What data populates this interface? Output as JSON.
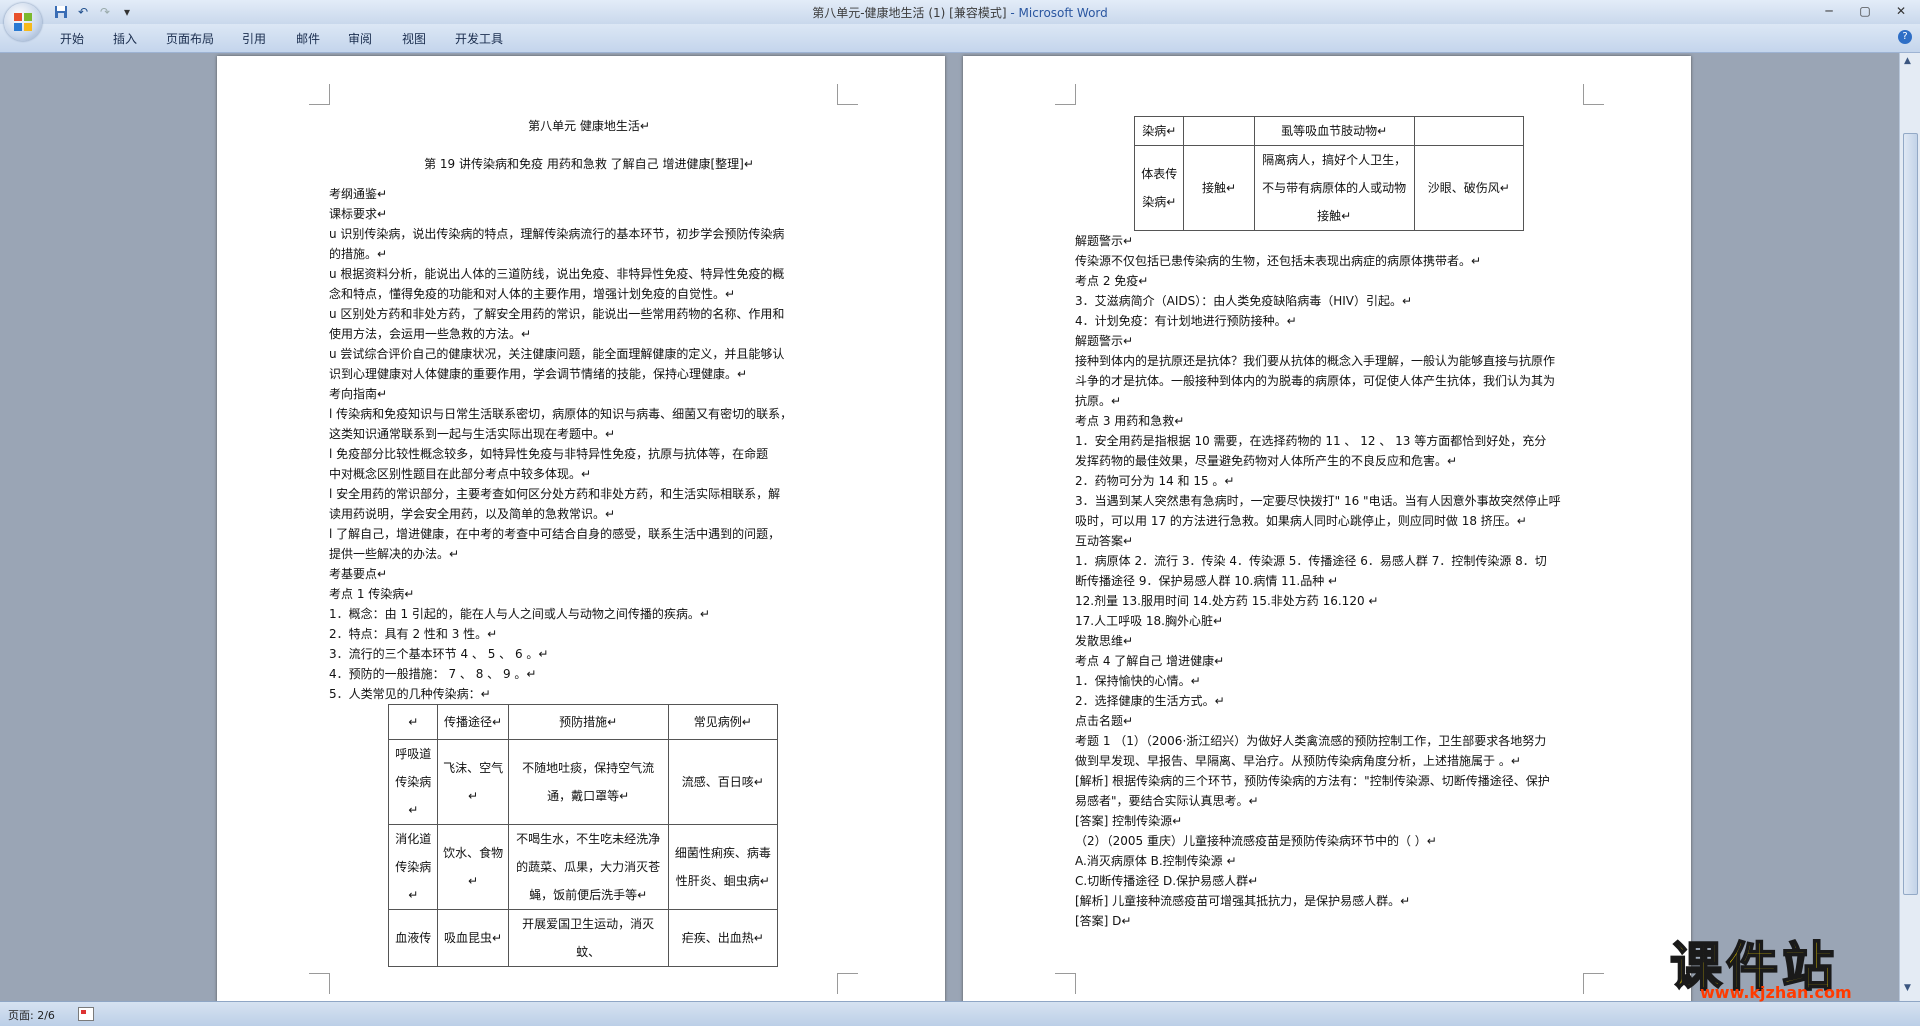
{
  "window": {
    "title": "第八单元-健康地生活 (1) [兼容模式]",
    "app_name": " - Microsoft Word"
  },
  "qat": {
    "undo_icon": "↶",
    "redo_icon": "↷",
    "more_icon": "▾"
  },
  "tabs": [
    "开始",
    "插入",
    "页面布局",
    "引用",
    "邮件",
    "审阅",
    "视图",
    "开发工具"
  ],
  "status": {
    "page": "页面: 2/6"
  },
  "watermark": {
    "cn": "课件站",
    "url": "www.kjzhan.com"
  },
  "page1": {
    "title1": "第八单元 健康地生活↵",
    "title2": "第 19 讲传染病和免疫 用药和急救 了解自己 增进健康[整理]↵",
    "lines": [
      "考纲通鉴↵",
      "课标要求↵",
      "u 识别传染病，说出传染病的特点，理解传染病流行的基本环节，初步学会预防传染病",
      "的措施。↵",
      "u 根据资料分析，能说出人体的三道防线，说出免疫、非特异性免疫、特异性免疫的概",
      "念和特点，懂得免疫的功能和对人体的主要作用，增强计划免疫的自觉性。↵",
      "u 区别处方药和非处方药，了解安全用药的常识，能说出一些常用药物的名称、作用和",
      "使用方法，会运用一些急救的方法。↵",
      "u 尝试综合评价自己的健康状况，关注健康问题，能全面理解健康的定义，并且能够认",
      "识到心理健康对人体健康的重要作用，学会调节情绪的技能，保持心理健康。↵",
      "考向指南↵",
      "l 传染病和免疫知识与日常生活联系密切，病原体的知识与病毒、细菌又有密切的联系，",
      "这类知识通常联系到一起与生活实际出现在考题中。↵",
      "l 免疫部分比较性概念较多，如特异性免疫与非特异性免疫，抗原与抗体等，在命题",
      "中对概念区别性题目在此部分考点中较多体现。↵",
      "l 安全用药的常识部分，主要考查如何区分处方药和非处方药，和生活实际相联系，解",
      "读用药说明，学会安全用药，以及简单的急救常识。↵",
      "l 了解自己，增进健康，在中考的考查中可结合自身的感受，联系生活中遇到的问题，",
      "提供一些解决的办法。↵",
      "考基要点↵",
      "考点 1 传染病↵",
      "1．概念：由 1 引起的，能在人与人之间或人与动物之间传播的疾病。↵",
      "2．特点：具有 2 性和 3 性。↵",
      "3．流行的三个基本环节 4 、 5 、 6 。↵",
      "4．预防的一般措施： 7 、 8 、 9 。↵",
      "5．人类常见的几种传染病：↵"
    ],
    "table": {
      "header": [
        "↵",
        "传播途径↵",
        "预防措施↵",
        "常见病例↵"
      ],
      "rows": [
        [
          "呼吸道传染病↵",
          "飞沫、空气↵",
          "不随地吐痰，保持空气流通，戴口罩等↵",
          "流感、百日咳↵"
        ],
        [
          "消化道传染病↵",
          "饮水、食物↵",
          "不喝生水，不生吃未经洗净的蔬菜、瓜果，大力消灭苍蝇，饭前便后洗手等↵",
          "细菌性痢疾、病毒性肝炎、蛔虫病↵"
        ],
        [
          "血液传",
          "吸血昆虫↵",
          "开展爱国卫生运动，消灭蚊、",
          "疟疾、出血热↵"
        ]
      ]
    }
  },
  "page2": {
    "table": {
      "rows": [
        [
          "染病↵",
          "",
          "虱等吸血节肢动物↵",
          ""
        ],
        [
          "体表传染病↵",
          "接触↵",
          "隔离病人，搞好个人卫生，不与带有病原体的人或动物接触↵",
          "沙眼、破伤风↵"
        ]
      ]
    },
    "lines": [
      "解题警示↵",
      "传染源不仅包括已患传染病的生物，还包括未表现出病症的病原体携带者。↵",
      "考点 2 免疫↵",
      "3．艾滋病简介（AIDS）：由人类免疫缺陷病毒（HIV）引起。↵",
      "4．计划免疫：有计划地进行预防接种。↵",
      "解题警示↵",
      "接种到体内的是抗原还是抗体？我们要从抗体的概念入手理解，一般认为能够直接与抗原作",
      "斗争的才是抗体。一般接种到体内的为脱毒的病原体，可促使人体产生抗体，我们认为其为",
      "抗原。↵",
      "考点 3 用药和急救↵",
      "1．安全用药是指根据 10 需要，在选择药物的 11 、 12 、 13 等方面都恰到好处，充分",
      "发挥药物的最佳效果，尽量避免药物对人体所产生的不良反应和危害。↵",
      "2．药物可分为 14 和 15 。↵",
      "3．当遇到某人突然患有急病时，一定要尽快拨打\" 16 \"电话。当有人因意外事故突然停止呼",
      "吸时，可以用 17 的方法进行急救。如果病人同时心跳停止，则应同时做 18 挤压。↵",
      "互动答案↵",
      "1．病原体 2．流行 3．传染 4．传染源 5．传播途径 6．易感人群 7．控制传染源 8．切",
      "断传播途径 9．保护易感人群 10.病情 11.品种 ↵",
      "12.剂量 13.服用时间 14.处方药 15.非处方药 16.120 ↵",
      "17.人工呼吸 18.胸外心脏↵",
      "发散思维↵",
      "考点 4 了解自己 增进健康↵",
      "1．保持愉快的心情。↵",
      "2．选择健康的生活方式。↵",
      "点击名题↵",
      "考题 1 （1）（2006·浙江绍兴）为做好人类禽流感的预防控制工作，卫生部要求各地努力",
      "做到早发现、早报告、早隔离、早治疗。从预防传染病角度分析，上述措施属于 。↵",
      "[解析] 根据传染病的三个环节，预防传染病的方法有：\"控制传染源、切断传播途径、保护",
      "易感者\"，要结合实际认真思考。↵",
      "[答案] 控制传染源↵",
      "（2）（2005 重庆）儿童接种流感疫苗是预防传染病环节中的（ ）↵",
      "A.消灭病原体 B.控制传染源 ↵",
      "C.切断传播途径 D.保护易感人群↵",
      "[解析] 儿童接种流感疫苗可增强其抵抗力，是保护易感人群。↵",
      "[答案] D↵"
    ]
  }
}
